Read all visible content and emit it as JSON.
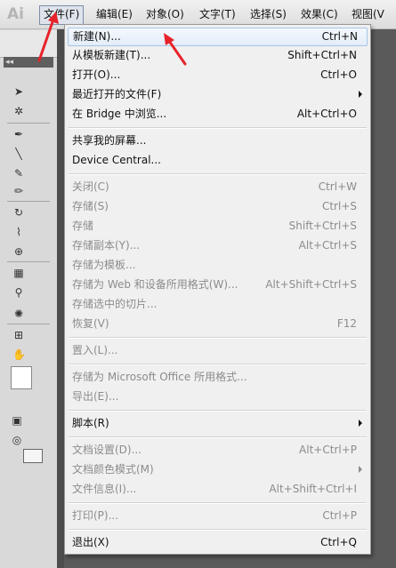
{
  "app": {
    "logo_text": "Ai"
  },
  "menubar": {
    "items": [
      {
        "label": "文件(F)",
        "open": true
      },
      {
        "label": "编辑(E)"
      },
      {
        "label": "对象(O)"
      },
      {
        "label": "文字(T)"
      },
      {
        "label": "选择(S)"
      },
      {
        "label": "效果(C)"
      },
      {
        "label": "视图(V"
      }
    ]
  },
  "file_menu": {
    "items": [
      {
        "label": "新建(N)...",
        "shortcut": "Ctrl+N",
        "highlighted": true
      },
      {
        "label": "从模板新建(T)...",
        "shortcut": "Shift+Ctrl+N"
      },
      {
        "label": "打开(O)...",
        "shortcut": "Ctrl+O"
      },
      {
        "label": "最近打开的文件(F)",
        "shortcut": "",
        "submenu": true
      },
      {
        "label": "在 Bridge 中浏览...",
        "shortcut": "Alt+Ctrl+O"
      },
      {
        "label": "共享我的屏幕..."
      },
      {
        "label": "Device Central..."
      },
      {
        "label": "关闭(C)",
        "shortcut": "Ctrl+W",
        "disabled": true
      },
      {
        "label": "存储(S)",
        "shortcut": "Ctrl+S",
        "disabled": true
      },
      {
        "label": "存储",
        "shortcut": "Shift+Ctrl+S",
        "disabled": true
      },
      {
        "label": "存储副本(Y)...",
        "shortcut": "Alt+Ctrl+S",
        "disabled": true
      },
      {
        "label": "存储为模板...",
        "disabled": true
      },
      {
        "label": "存储为 Web 和设备所用格式(W)...",
        "shortcut": "Alt+Shift+Ctrl+S",
        "disabled": true
      },
      {
        "label": "存储选中的切片...",
        "disabled": true
      },
      {
        "label": "恢复(V)",
        "shortcut": "F12",
        "disabled": true
      },
      {
        "label": "置入(L)...",
        "disabled": true
      },
      {
        "label": "存储为 Microsoft Office 所用格式...",
        "disabled": true
      },
      {
        "label": "导出(E)...",
        "disabled": true
      },
      {
        "label": "脚本(R)",
        "submenu": true
      },
      {
        "label": "文档设置(D)...",
        "shortcut": "Alt+Ctrl+P",
        "disabled": true
      },
      {
        "label": "文档颜色模式(M)",
        "submenu": true,
        "disabled": true
      },
      {
        "label": "文件信息(I)...",
        "shortcut": "Alt+Shift+Ctrl+I",
        "disabled": true
      },
      {
        "label": "打印(P)...",
        "shortcut": "Ctrl+P",
        "disabled": true
      },
      {
        "label": "退出(X)",
        "shortcut": "Ctrl+Q"
      }
    ]
  },
  "colors": {
    "annotation_arrow": "#e8222a",
    "highlight": "#e3edf9"
  }
}
